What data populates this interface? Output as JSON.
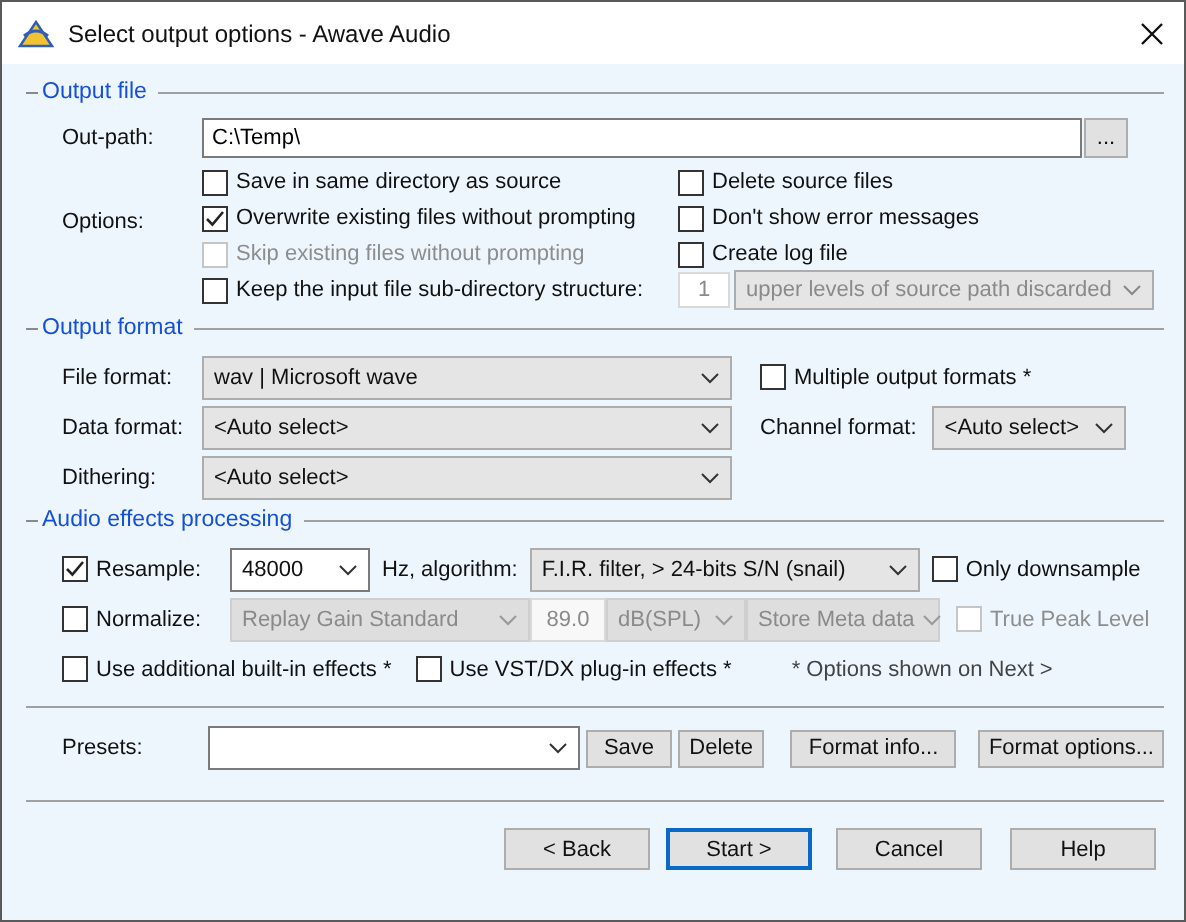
{
  "window": {
    "title": "Select output options - Awave Audio"
  },
  "output_file": {
    "title": "Output file",
    "out_path": {
      "label": "Out-path:",
      "value": "C:\\Temp\\"
    },
    "browse_button": "...",
    "options_label": "Options:",
    "options_left": [
      {
        "label": "Save in same directory as source",
        "checked": false,
        "disabled": false
      },
      {
        "label": "Overwrite existing files without prompting",
        "checked": true,
        "disabled": false
      },
      {
        "label": "Skip existing files without prompting",
        "checked": false,
        "disabled": true
      }
    ],
    "options_right": [
      {
        "label": "Delete source files",
        "checked": false,
        "disabled": false
      },
      {
        "label": "Don't show error messages",
        "checked": false,
        "disabled": false
      },
      {
        "label": "Create log file",
        "checked": false,
        "disabled": false
      }
    ],
    "keep_structure": {
      "label": "Keep the input file sub-directory structure:",
      "checked": false
    },
    "levels": {
      "value": "1",
      "disabled": true
    },
    "levels_mode": {
      "value": "upper levels of source path discarded",
      "disabled": true
    }
  },
  "output_format": {
    "title": "Output format",
    "file_format": {
      "label": "File format:",
      "value": "wav | Microsoft wave"
    },
    "multiple": {
      "label": "Multiple output formats *",
      "checked": false
    },
    "data_format": {
      "label": "Data format:",
      "value": "<Auto select>"
    },
    "channel_format": {
      "label": "Channel format:",
      "value": "<Auto select>"
    },
    "dithering": {
      "label": "Dithering:",
      "value": "<Auto select>"
    }
  },
  "audio_effects": {
    "title": "Audio effects processing",
    "resample": {
      "label": "Resample:",
      "checked": true
    },
    "rate": "48000",
    "algorithm_label": "Hz, algorithm:",
    "algorithm": "F.I.R. filter, > 24-bits S/N (snail)",
    "only_downsample": {
      "label": "Only downsample",
      "checked": false
    },
    "normalize": {
      "label": "Normalize:",
      "checked": false
    },
    "normalize_mode": {
      "value": "Replay Gain Standard",
      "disabled": true
    },
    "normalize_level": {
      "value": "89.0",
      "disabled": true
    },
    "normalize_unit": {
      "value": "dB(SPL)",
      "disabled": true
    },
    "meta": {
      "value": "Store Meta data",
      "disabled": true
    },
    "true_peak": {
      "label": "True Peak Level",
      "checked": false,
      "disabled": true
    },
    "builtin": {
      "label": "Use additional built-in effects *",
      "checked": false
    },
    "vst": {
      "label": "Use VST/DX plug-in effects *",
      "checked": false
    },
    "note": "* Options shown on Next >"
  },
  "presets": {
    "label": "Presets:",
    "buttons": [
      "Save",
      "Delete",
      "Format info...",
      "Format options..."
    ]
  },
  "footer_buttons": [
    {
      "label": "< Back",
      "default": false
    },
    {
      "label": "Start >",
      "default": true
    },
    {
      "label": "Cancel",
      "default": false
    },
    {
      "label": "Help",
      "default": false
    }
  ]
}
